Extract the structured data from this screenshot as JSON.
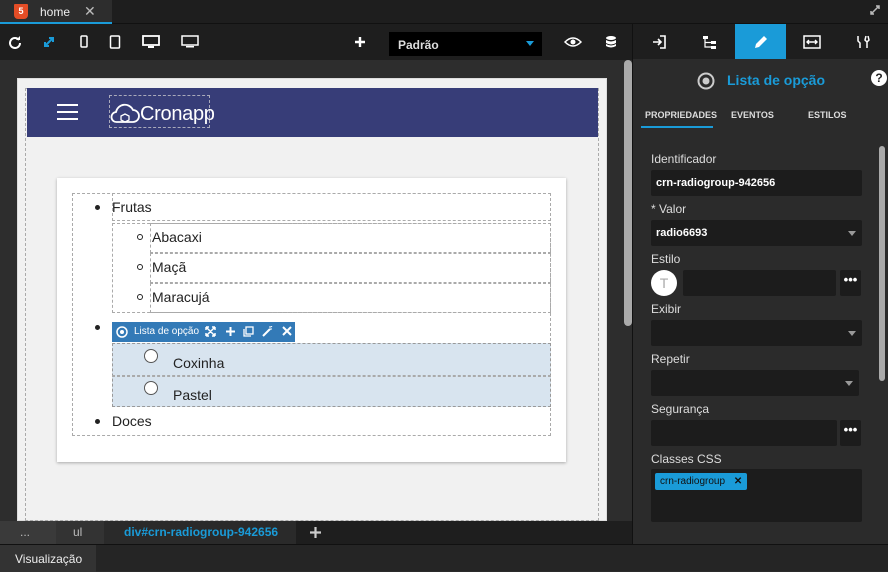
{
  "tabbar": {
    "tab_label": "home",
    "close": "✕",
    "html_badge": "5"
  },
  "toolbar": {
    "select_value": "Padrão"
  },
  "navbar": {
    "logo_text": "Cronapp"
  },
  "list": {
    "items": [
      {
        "label": "Frutas",
        "children": [
          "Abacaxi",
          "Maçã",
          "Maracujá"
        ]
      },
      {
        "label": "",
        "radios": [
          "Coxinha",
          "Pastel"
        ]
      },
      {
        "label": "Doces"
      }
    ],
    "component_chip": "Lista de opção"
  },
  "breadcrumb": [
    "...",
    "ul",
    "div#crn-radiogroup-942656"
  ],
  "status": {
    "tab": "Visualização"
  },
  "panel": {
    "title": "Lista de opção",
    "help": "?",
    "tabs": [
      "PROPRIEDADES",
      "EVENTOS",
      "ESTILOS"
    ],
    "fields": {
      "identificador_label": "Identificador",
      "identificador_value": "crn-radiogroup-942656",
      "valor_label": "* Valor",
      "valor_value": "radio6693",
      "estilo_label": "Estilo",
      "estilo_avatar": "T",
      "exibir_label": "Exibir",
      "repetir_label": "Repetir",
      "seguranca_label": "Segurança",
      "classes_label": "Classes CSS",
      "classes_tag": "crn-radiogroup",
      "more": "•••"
    }
  },
  "colors": {
    "accent": "#1a9bd8",
    "navbar": "#373d78",
    "chip": "#337ab7"
  }
}
